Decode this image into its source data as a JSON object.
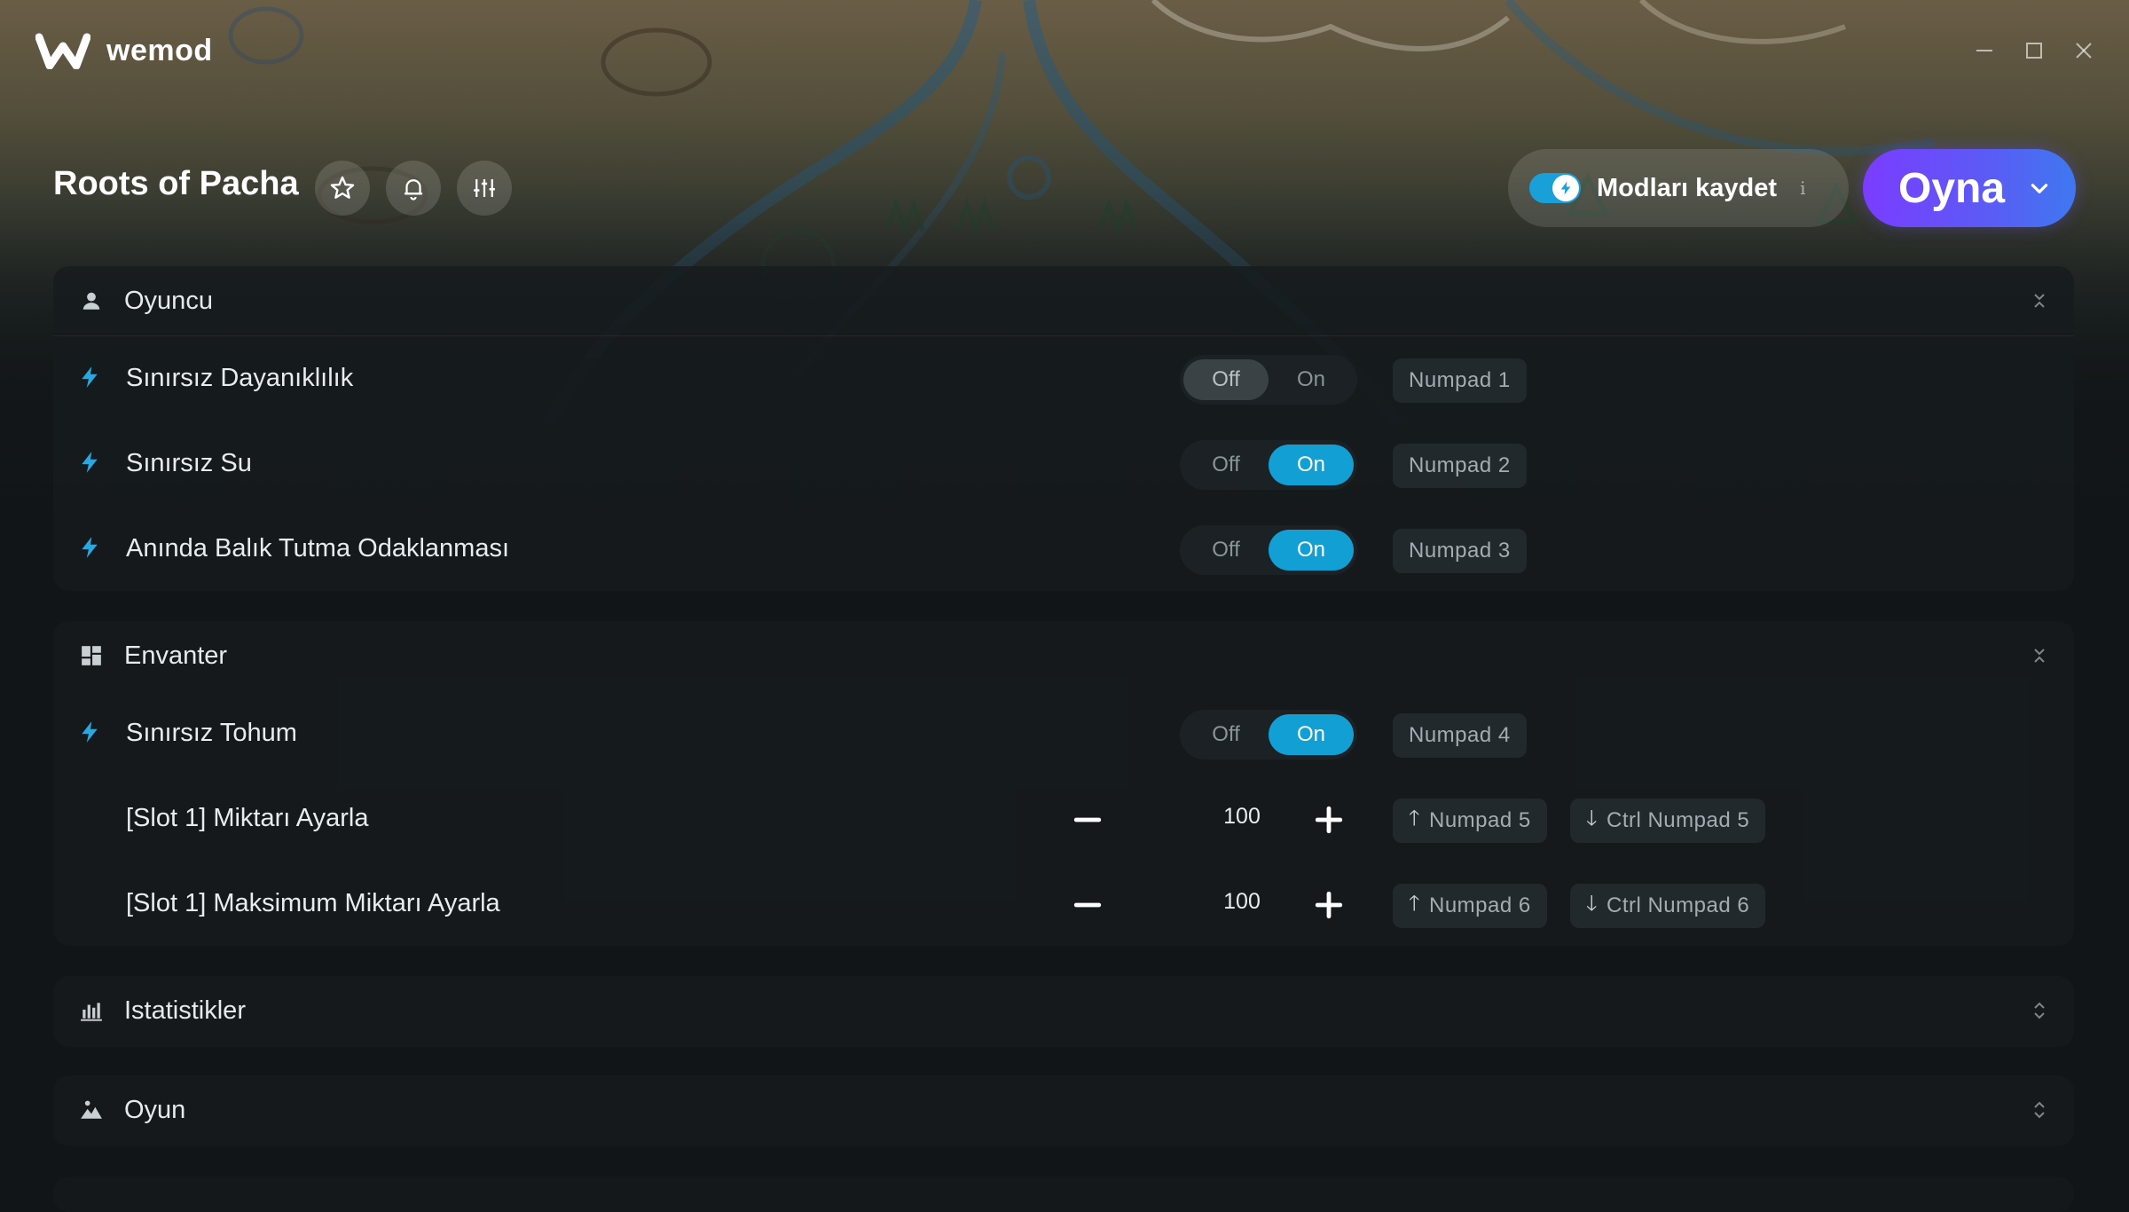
{
  "app": {
    "name": "wemod"
  },
  "header": {
    "game_title": "Roots of Pacha",
    "save_mods_label": "Modları kaydet",
    "info_glyph": "i",
    "play_label": "Oyna"
  },
  "icons": {
    "favorite": "star-icon",
    "notifications": "bell-icon",
    "settings": "sliders-icon",
    "play_menu": "chevron-down-icon"
  },
  "colors": {
    "accent": "#12a0d4",
    "play_gradient_start": "#7b3cff",
    "play_gradient_end": "#3f78f0"
  },
  "sections": [
    {
      "title": "Oyuncu",
      "icon": "person-icon",
      "expanded": true,
      "rows": [
        {
          "type": "toggle",
          "label": "Sınırsız Dayanıklılık",
          "off_label": "Off",
          "on_label": "On",
          "state": "off",
          "hotkey": "Numpad 1"
        },
        {
          "type": "toggle",
          "label": "Sınırsız Su",
          "off_label": "Off",
          "on_label": "On",
          "state": "on",
          "hotkey": "Numpad 2"
        },
        {
          "type": "toggle",
          "label": "Anında Balık Tutma Odaklanması",
          "off_label": "Off",
          "on_label": "On",
          "state": "on",
          "hotkey": "Numpad 3"
        }
      ]
    },
    {
      "title": "Envanter",
      "icon": "grid-icon",
      "expanded": true,
      "rows": [
        {
          "type": "toggle",
          "label": "Sınırsız Tohum",
          "off_label": "Off",
          "on_label": "On",
          "state": "on",
          "hotkey": "Numpad 4"
        },
        {
          "type": "number",
          "label": "[Slot 1] Miktarı Ayarla",
          "value": "100",
          "hotkey_up": "Numpad 5",
          "hotkey_down": "Ctrl Numpad 5"
        },
        {
          "type": "number",
          "label": "[Slot 1] Maksimum Miktarı Ayarla",
          "value": "100",
          "hotkey_up": "Numpad 6",
          "hotkey_down": "Ctrl Numpad 6"
        }
      ]
    },
    {
      "title": "Istatistikler",
      "icon": "bar-chart-icon",
      "expanded": false
    },
    {
      "title": "Oyun",
      "icon": "landscape-icon",
      "expanded": false
    }
  ]
}
